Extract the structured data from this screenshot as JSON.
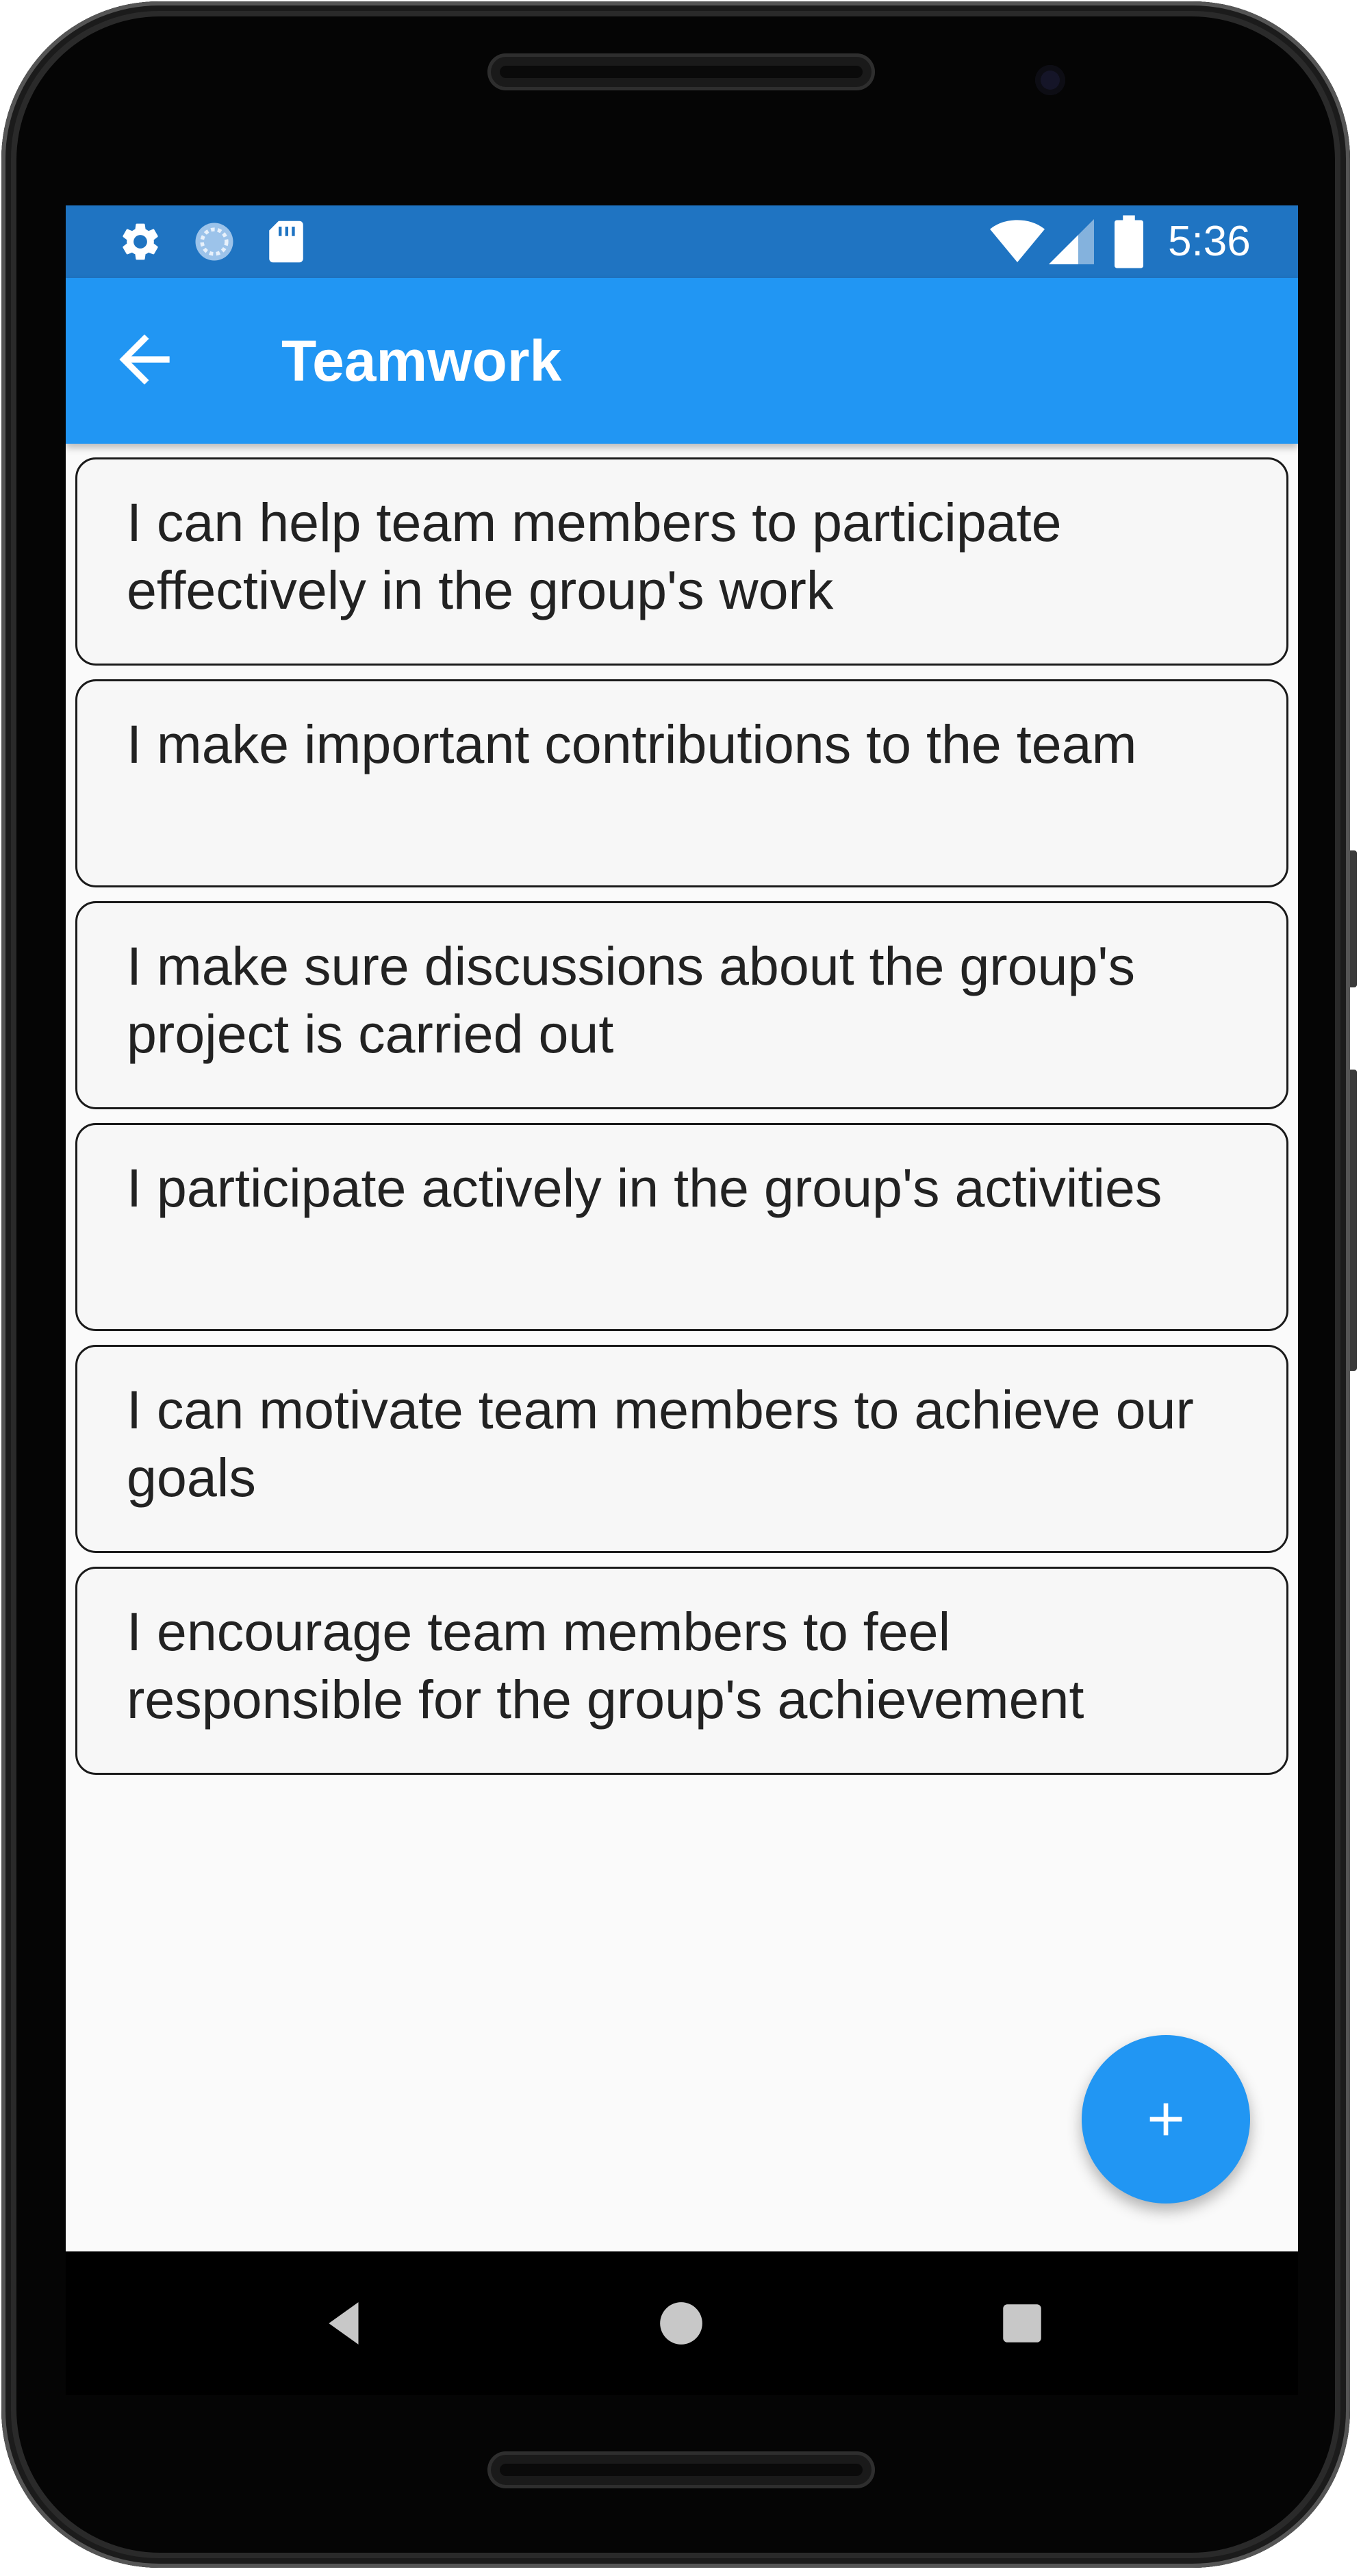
{
  "status_bar": {
    "time": "5:36",
    "icons": [
      "settings-icon",
      "sync-icon",
      "sd-card-icon",
      "wifi-icon",
      "signal-icon",
      "battery-icon"
    ]
  },
  "app_bar": {
    "title": "Teamwork",
    "back_icon": "arrow-back-icon"
  },
  "items": [
    {
      "text": "I can help team members to participate effectively in the group's work"
    },
    {
      "text": "I make important contributions to the team"
    },
    {
      "text": "I make sure discussions about the group's project is carried out"
    },
    {
      "text": "I participate actively in the group's activities"
    },
    {
      "text": "I can motivate team members to achieve our goals"
    },
    {
      "text": "I encourage team members to feel responsible for the group's achievement"
    }
  ],
  "fab": {
    "icon": "plus-icon"
  },
  "nav_bar": {
    "icons": [
      "back-triangle-icon",
      "home-circle-icon",
      "recents-square-icon"
    ]
  },
  "colors": {
    "primary": "#2196f3",
    "status_bar": "#1f74c2",
    "background": "#fafafa"
  }
}
